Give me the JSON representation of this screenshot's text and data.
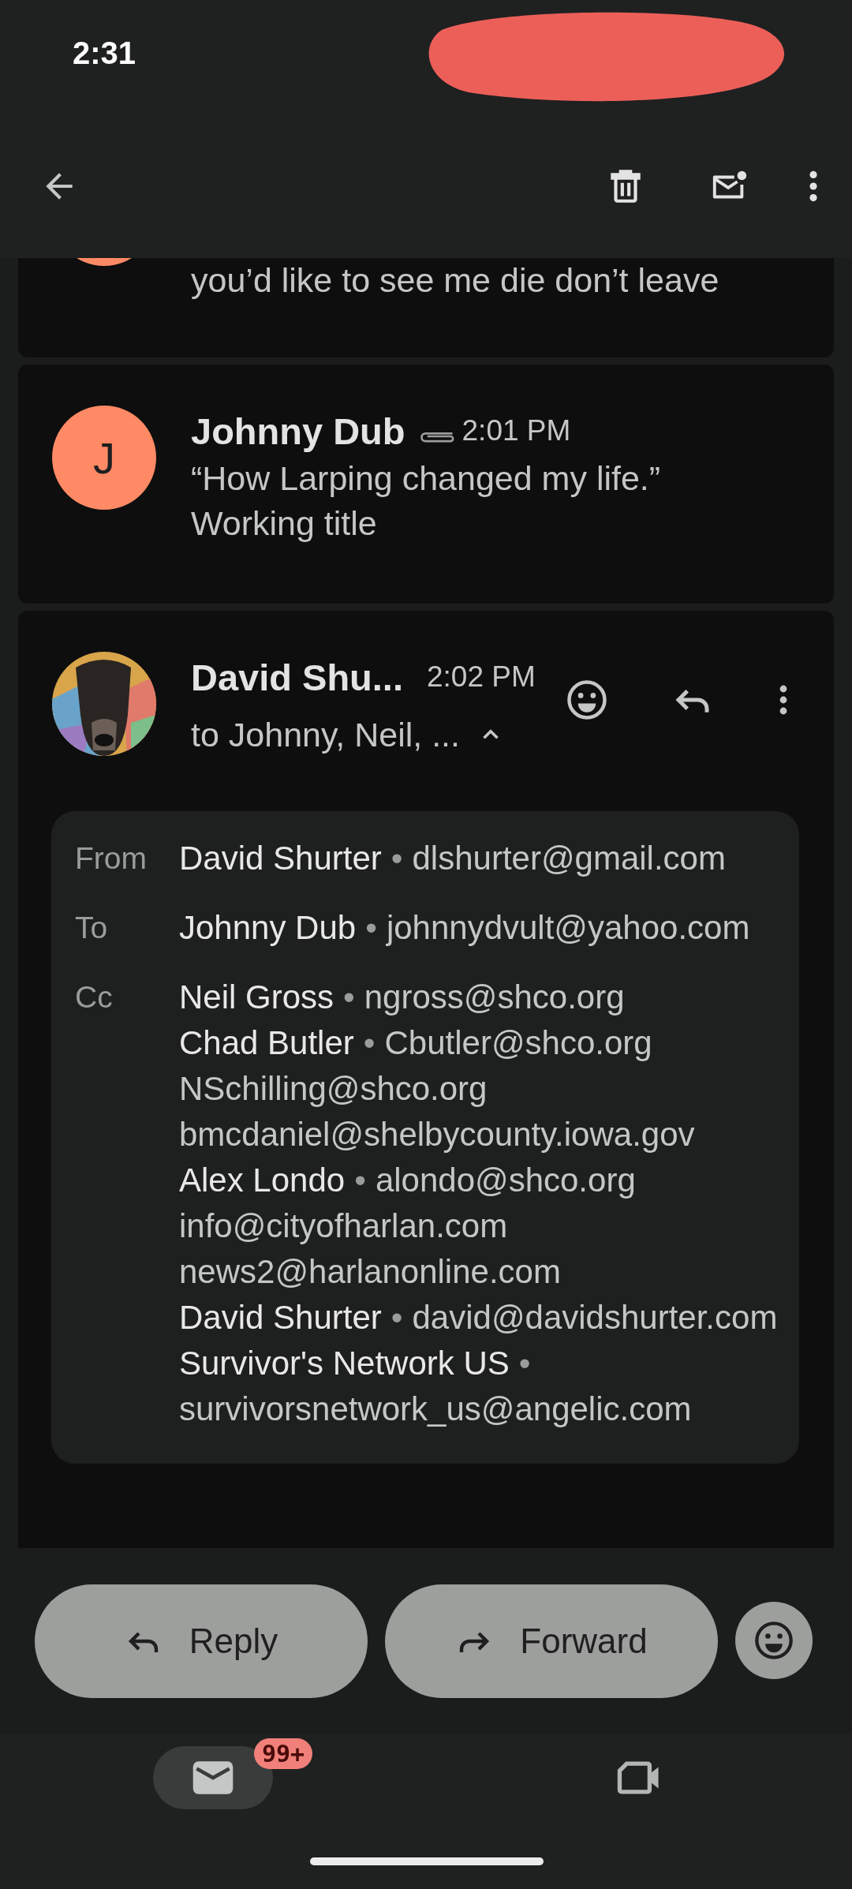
{
  "status_bar": {
    "time": "2:31"
  },
  "messages": [
    {
      "kind": "partial",
      "color": "#ff8a65",
      "snippet": "you’d like to see me die don’t leave"
    },
    {
      "kind": "collapsed",
      "avatar_letter": "J",
      "color": "#ff8a65",
      "sender": "Johnny Dub",
      "has_attachment": true,
      "time": "2:01 PM",
      "snippet": "“How Larping changed my life.” Working title"
    },
    {
      "kind": "expanded",
      "sender": "David Shu...",
      "time": "2:02 PM",
      "recipients_summary": "to Johnny, Neil, ...",
      "details_open": true,
      "details": {
        "separator": "•",
        "fields": [
          {
            "label": "From",
            "people": [
              {
                "name": "David Shurter",
                "email": "dlshurter@gmail.com"
              }
            ]
          },
          {
            "label": "To",
            "people": [
              {
                "name": "Johnny Dub",
                "email": "johnnydvult@yahoo.com"
              }
            ]
          },
          {
            "label": "Cc",
            "people": [
              {
                "name": "Neil Gross",
                "email": "ngross@shco.org"
              },
              {
                "name": "Chad Butler",
                "email": "Cbutler@shco.org"
              },
              {
                "email": "NSchilling@shco.org"
              },
              {
                "email": "bmcdaniel@shelbycounty.iowa.gov"
              },
              {
                "name": "Alex Londo",
                "email": "alondo@shco.org"
              },
              {
                "email": "info@cityofharlan.com"
              },
              {
                "email": "news2@harlanonline.com"
              },
              {
                "name": "David Shurter",
                "email": "david@davidshurter.com"
              },
              {
                "name": "Survivor's Network US",
                "email": "survivorsnetwork_us@angelic.com"
              }
            ]
          }
        ]
      }
    }
  ],
  "actions": [
    "Reply",
    "Forward"
  ],
  "nav": {
    "mail_badge": "99+",
    "tabs": [
      {
        "kind": "mail",
        "selected": true
      },
      {
        "kind": "meet",
        "selected": false
      }
    ]
  }
}
